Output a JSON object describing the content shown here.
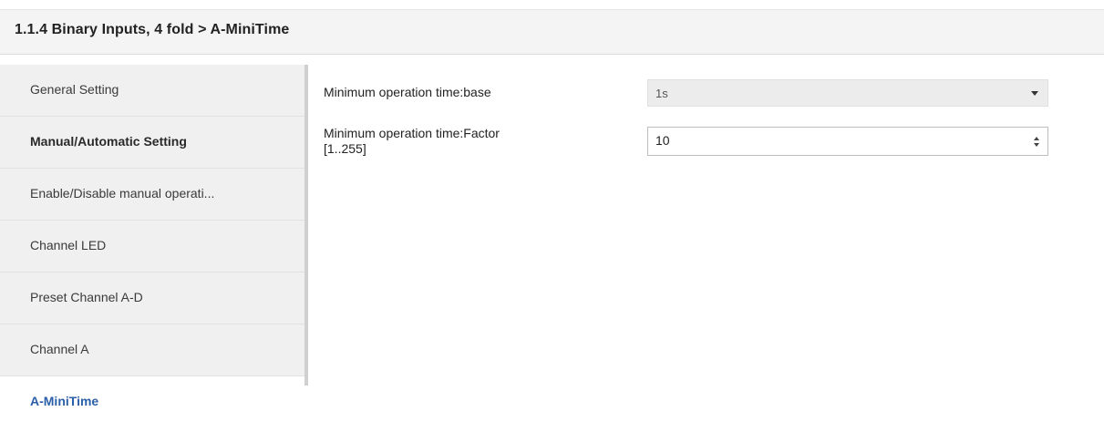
{
  "header": {
    "title": "1.1.4 Binary Inputs, 4 fold > A-MiniTime"
  },
  "sidebar": {
    "items": [
      {
        "label": "General Setting"
      },
      {
        "label": "Manual/Automatic Setting"
      },
      {
        "label": "Enable/Disable manual operati..."
      },
      {
        "label": "Channel LED"
      },
      {
        "label": "Preset Channel A-D"
      },
      {
        "label": "Channel A"
      },
      {
        "label": "A-MiniTime"
      }
    ]
  },
  "params": {
    "base": {
      "label": "Minimum operation time:base",
      "value": "1s"
    },
    "factor": {
      "label_line1": "Minimum operation time:Factor",
      "label_line2": "[1..255]",
      "value": "10"
    }
  },
  "colors": {
    "active_item": "#2b5fa8",
    "sidebar_bg": "#f0f0f0",
    "header_bg": "#f4f4f4"
  }
}
